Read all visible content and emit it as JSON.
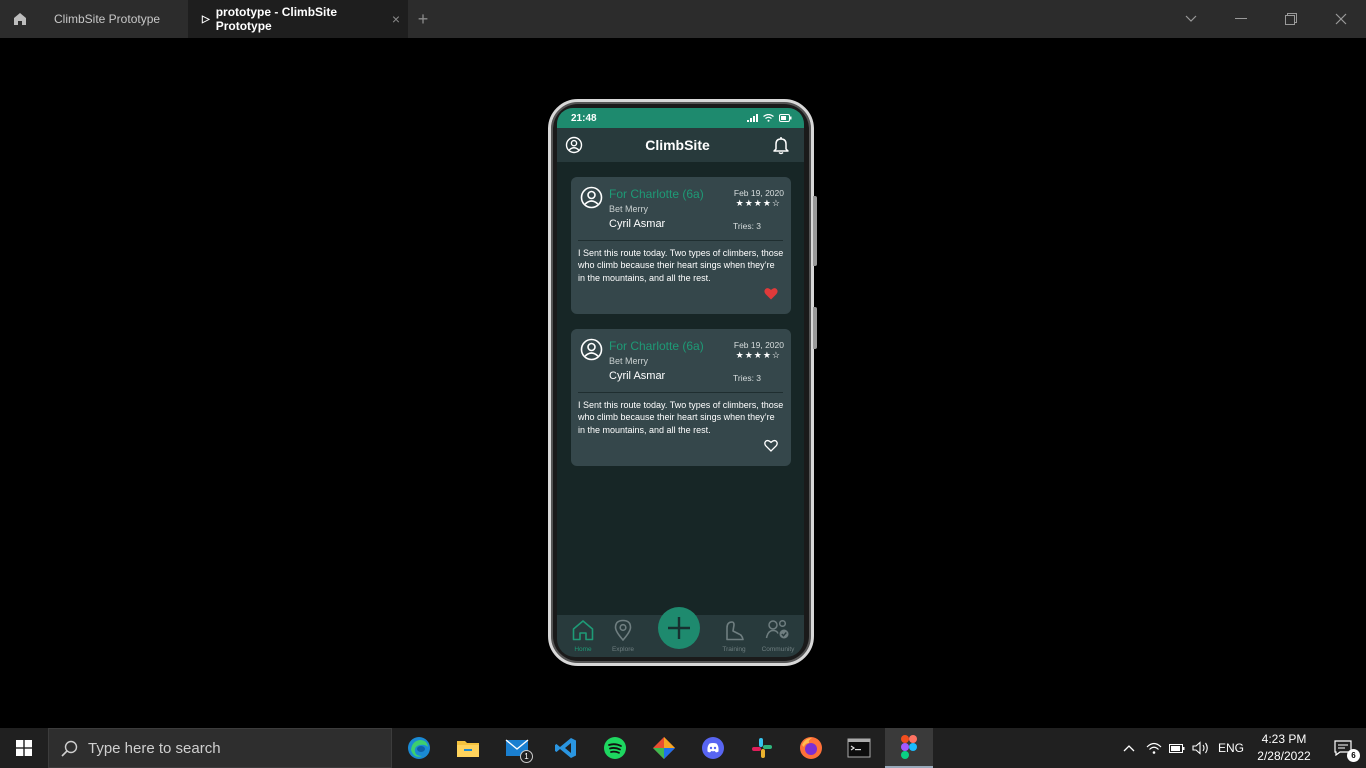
{
  "window": {
    "tabs": [
      {
        "label": "ClimbSite Prototype"
      },
      {
        "label": "prototype - ClimbSite Prototype",
        "close": "×"
      }
    ],
    "add_tab": "+"
  },
  "app": {
    "status_time": "21:48",
    "title": "ClimbSite",
    "posts": [
      {
        "route": "For Charlotte (6a)",
        "setter": "Bet Merry",
        "user": "Cyril Asmar",
        "date": "Feb 19, 2020",
        "stars": "★★★★☆",
        "rating": 4,
        "tries": "Tries: 3",
        "body": "I Sent this route today. Two types of climbers, those who climb because their heart sings when they’re in the mountains, and all the rest.",
        "liked": true
      },
      {
        "route": "For Charlotte (6a)",
        "setter": "Bet Merry",
        "user": "Cyril Asmar",
        "date": "Feb 19, 2020",
        "stars": "★★★★☆",
        "rating": 4,
        "tries": "Tries: 3",
        "body": "I Sent this route today. Two types of climbers, those who climb because their heart sings when they’re in the mountains, and all the rest.",
        "liked": false
      }
    ],
    "nav": [
      {
        "label": "Home",
        "icon": "home-icon",
        "active": true
      },
      {
        "label": "Explore",
        "icon": "location-pin-icon"
      },
      {
        "label": "Training",
        "icon": "climber-icon"
      },
      {
        "label": "Community",
        "icon": "community-icon"
      }
    ],
    "colors": {
      "accent": "#1e8a6e",
      "heart": "#e03a3a",
      "card": "#35474b",
      "background": "#172626"
    }
  },
  "taskbar": {
    "search_placeholder": "Type here to search",
    "mail_badge": "1",
    "language": "ENG",
    "time": "4:23 PM",
    "date": "2/28/2022",
    "notification_count": "6"
  }
}
